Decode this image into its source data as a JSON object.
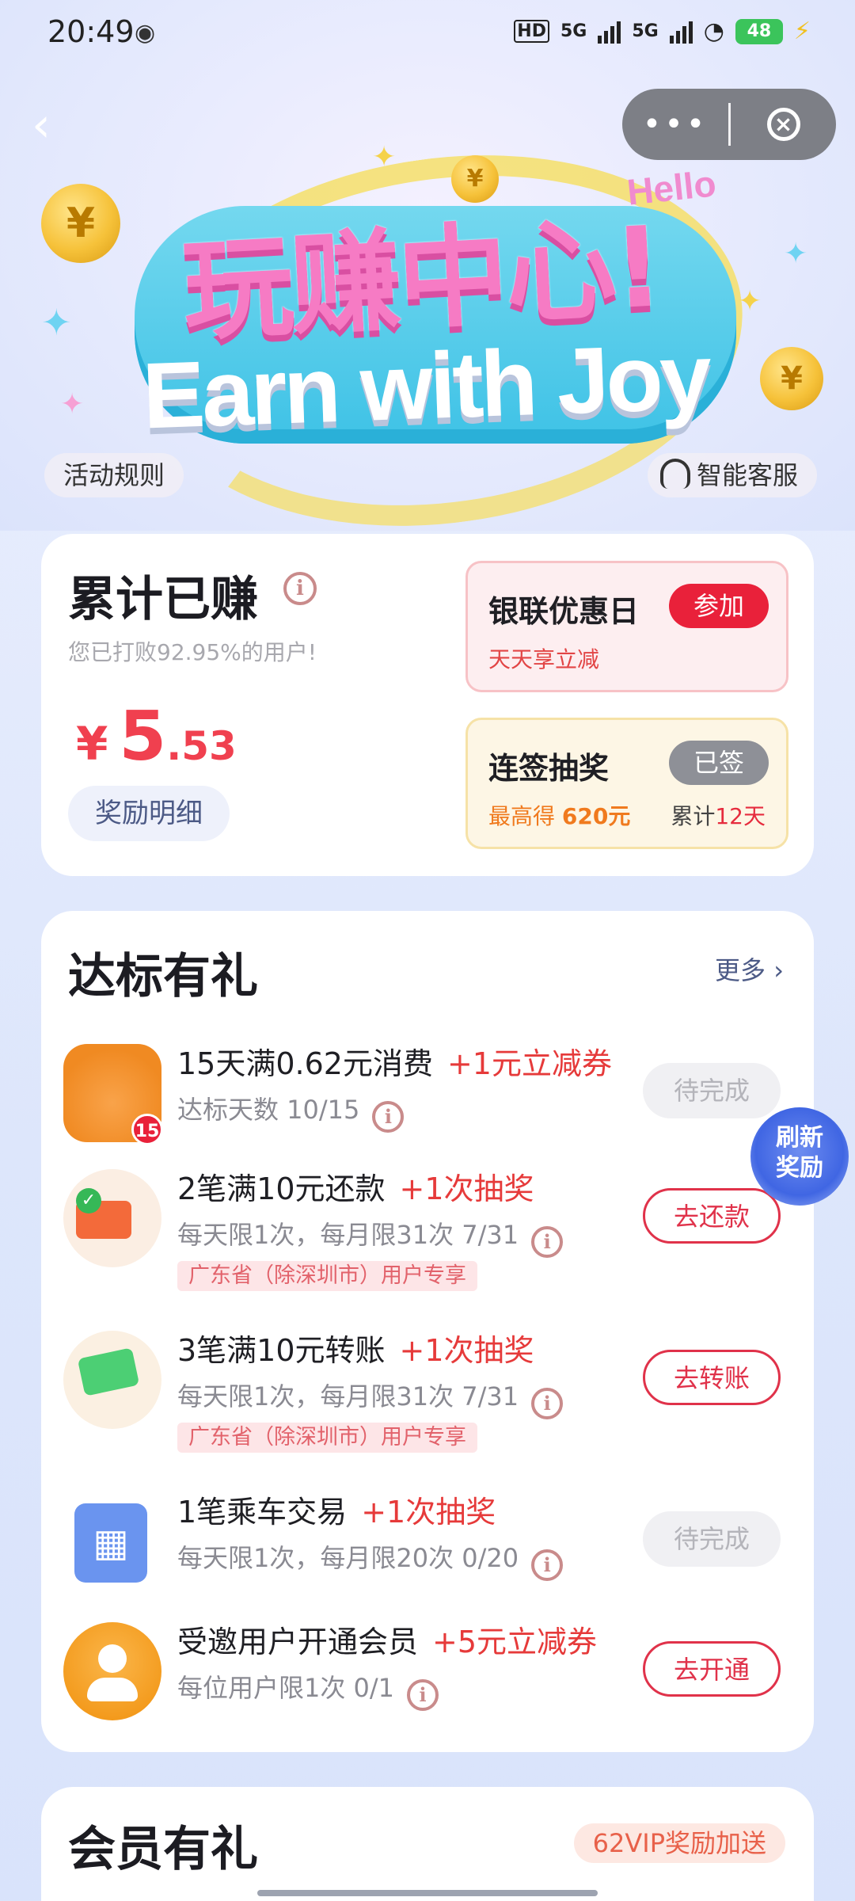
{
  "status_bar": {
    "time": "20:49",
    "network_labels": [
      "HD",
      "5G",
      "5G"
    ],
    "battery": "48"
  },
  "header": {
    "capsule_more": "•••",
    "hero_title_cn": "玩赚中心!",
    "hero_title_en": "Earn with Joy",
    "hero_hello": "Hello",
    "rules_label": "活动规则",
    "service_label": "智能客服"
  },
  "earnings": {
    "title": "累计已赚",
    "subtitle": "您已打败92.95%的用户!",
    "currency": "¥",
    "amount_int": "5",
    "amount_dec": ".53",
    "detail_label": "奖励明细",
    "unionpay": {
      "title": "银联优惠日",
      "button": "参加",
      "subtitle": "天天享立减"
    },
    "signin": {
      "title": "连签抽奖",
      "button": "已签",
      "subtitle_prefix": "最高得 ",
      "subtitle_value": "620元",
      "total_prefix": "累计",
      "total_value": "12天"
    }
  },
  "tasks": {
    "title": "达标有礼",
    "more_label": "更多 ›",
    "items": [
      {
        "title": "15天满0.62元消费",
        "reward": "+1元立减券",
        "desc": "达标天数 10/15",
        "tag": "",
        "button": "待完成",
        "icon": "gift-coins-icon",
        "icon_badge": "15"
      },
      {
        "title": "2笔满10元还款",
        "reward": "+1次抽奖",
        "desc": "每天限1次，每月限31次 7/31",
        "tag": "广东省（除深圳市）用户专享",
        "button": "去还款",
        "icon": "card-repay-icon"
      },
      {
        "title": "3笔满10元转账",
        "reward": "+1次抽奖",
        "desc": "每天限1次，每月限31次 7/31",
        "tag": "广东省（除深圳市）用户专享",
        "button": "去转账",
        "icon": "card-transfer-icon"
      },
      {
        "title": "1笔乘车交易",
        "reward": "+1次抽奖",
        "desc": "每天限1次，每月限20次 0/20",
        "tag": "",
        "button": "待完成",
        "icon": "qr-code-icon"
      },
      {
        "title": "受邀用户开通会员",
        "reward": "+5元立减券",
        "desc": "每位用户限1次 0/1",
        "tag": "",
        "button": "去开通",
        "icon": "user-avatar-icon"
      }
    ]
  },
  "refresh_float": {
    "line1": "刷新",
    "line2": "奖励"
  },
  "member": {
    "title": "会员有礼",
    "badge": "62VIP奖励加送"
  },
  "colors": {
    "accent_red": "#e9213a",
    "reward_red": "#e63a3a",
    "link_blue": "#4c5a86"
  }
}
